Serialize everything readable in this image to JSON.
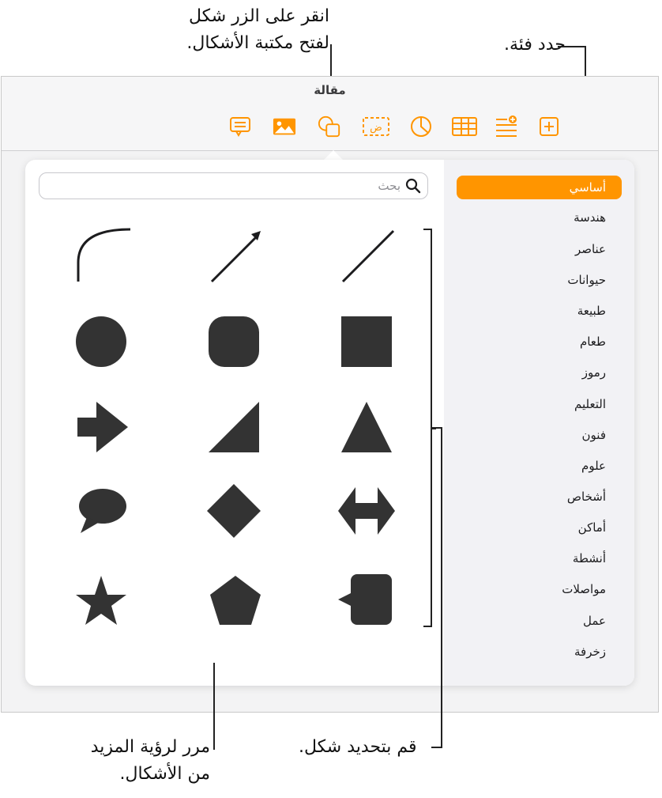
{
  "callouts": {
    "click_button": [
      "انقر على الزر شكل",
      "لفتح مكتبة الأشكال."
    ],
    "choose_category": "حدد فئة.",
    "scroll_more": [
      "مرر لرؤية المزيد",
      "من الأشكال."
    ],
    "choose_shape": "قم بتحديد شكل."
  },
  "window": {
    "title": "مقالة"
  },
  "toolbar": {
    "buttons": [
      {
        "name": "comment",
        "icon": "comment-icon"
      },
      {
        "name": "media",
        "icon": "image-icon"
      },
      {
        "name": "shape",
        "icon": "shape-icon"
      },
      {
        "name": "text",
        "icon": "text-box-icon",
        "glyph": "ض"
      },
      {
        "name": "chart",
        "icon": "chart-icon"
      },
      {
        "name": "table",
        "icon": "table-icon"
      },
      {
        "name": "insert",
        "icon": "list-add-icon"
      },
      {
        "name": "add-page",
        "icon": "add-icon"
      }
    ],
    "accent": "#ff9500"
  },
  "search": {
    "placeholder": "بحث",
    "value": ""
  },
  "categories": [
    {
      "label": "أساسي",
      "selected": true
    },
    {
      "label": "هندسة"
    },
    {
      "label": "عناصر"
    },
    {
      "label": "حيوانات"
    },
    {
      "label": "طبيعة"
    },
    {
      "label": "طعام"
    },
    {
      "label": "رموز"
    },
    {
      "label": "التعليم"
    },
    {
      "label": "فنون"
    },
    {
      "label": "علوم"
    },
    {
      "label": "أشخاص"
    },
    {
      "label": "أماكن"
    },
    {
      "label": "أنشطة"
    },
    {
      "label": "مواصلات"
    },
    {
      "label": "عمل"
    },
    {
      "label": "زخرفة"
    }
  ],
  "shapes": [
    [
      "curve-icon",
      "arrow-line-icon",
      "line-icon"
    ],
    [
      "circle-icon",
      "rounded-square-icon",
      "square-icon"
    ],
    [
      "right-arrow-icon",
      "right-triangle-icon",
      "triangle-icon"
    ],
    [
      "speech-bubble-icon",
      "diamond-icon",
      "double-arrow-icon"
    ],
    [
      "star-icon",
      "pentagon-icon",
      "callout-square-icon"
    ]
  ],
  "colors": {
    "shape_fill": "#333333",
    "selected_category": "#ff9500"
  }
}
